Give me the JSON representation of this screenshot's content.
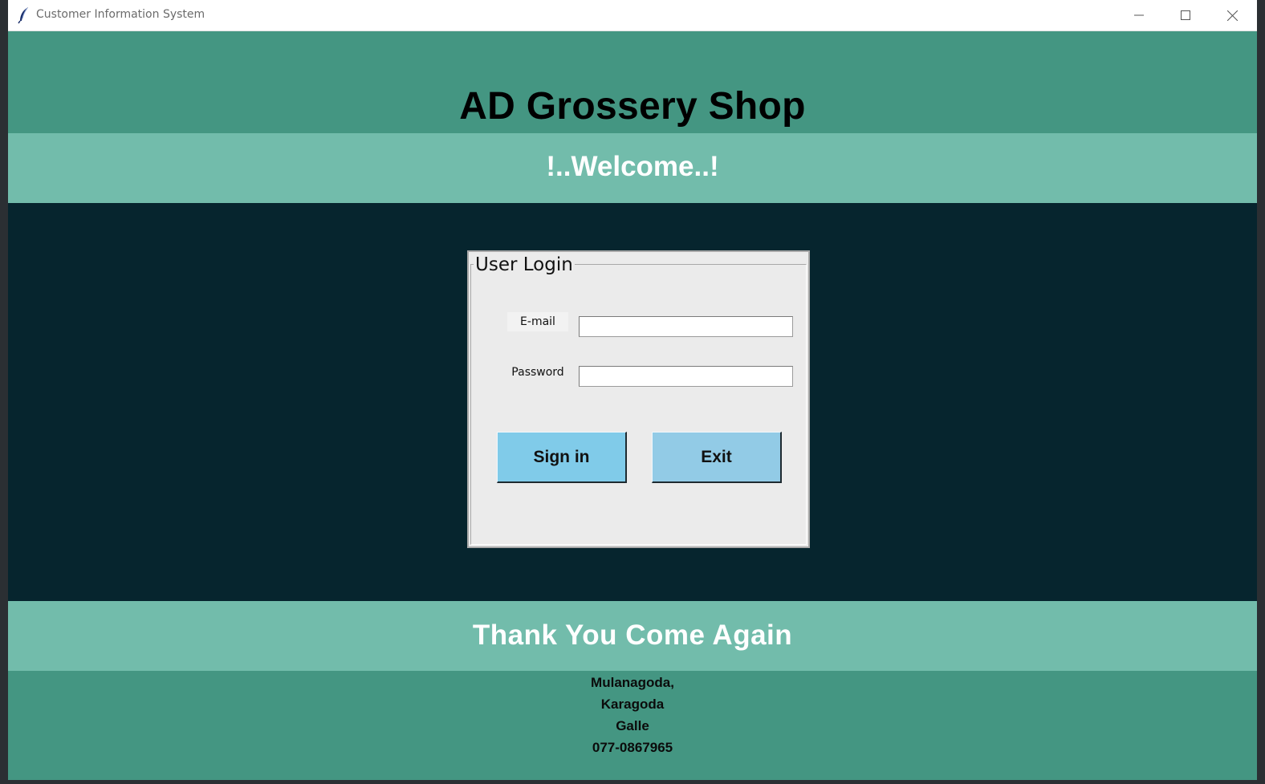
{
  "window": {
    "title": "Customer Information System"
  },
  "header": {
    "shop_name": "AD Grossery Shop",
    "welcome": "!..Welcome..!"
  },
  "login": {
    "legend": "User Login",
    "email_label": "E-mail",
    "email_value": "",
    "password_label": "Password",
    "password_value": "",
    "signin_label": "Sign in",
    "exit_label": "Exit"
  },
  "footer": {
    "thanks": "Thank You Come Again",
    "address": [
      "Mulanagoda,",
      "Karagoda",
      "Galle",
      "077-0867965"
    ]
  },
  "icons": {
    "app": "feather-icon",
    "minimize": "minimize-icon",
    "maximize": "maximize-icon",
    "close": "close-icon"
  },
  "colors": {
    "header_teal": "#449682",
    "band_light_teal": "#72bcab",
    "body_dark": "#06252e",
    "frame_gray": "#ebebeb",
    "signin_button": "#80cbe9",
    "exit_button": "#92cbe6"
  }
}
